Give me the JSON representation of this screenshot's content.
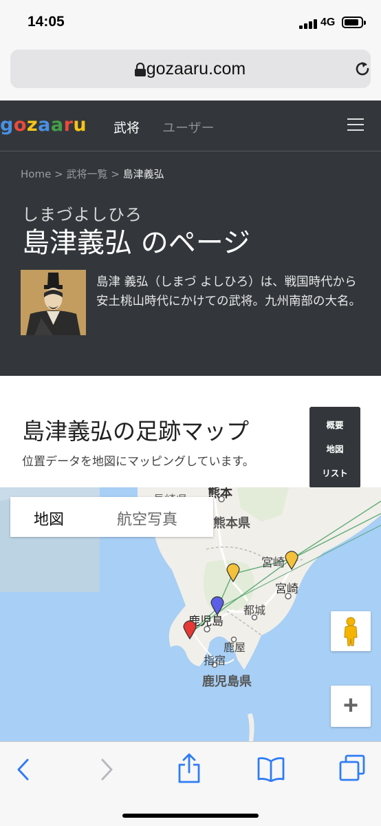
{
  "status": {
    "time": "14:05",
    "network": "4G"
  },
  "browser": {
    "url": "gozaaru.com"
  },
  "site": {
    "logo_letters": [
      {
        "ch": "g",
        "color": "#4a90e2"
      },
      {
        "ch": "o",
        "color": "#e94b3c"
      },
      {
        "ch": "z",
        "color": "#f5c518"
      },
      {
        "ch": "a",
        "color": "#4a90e2"
      },
      {
        "ch": "a",
        "color": "#43a047"
      },
      {
        "ch": "r",
        "color": "#e94b3c"
      },
      {
        "ch": "u",
        "color": "#f5c518"
      }
    ],
    "nav": {
      "busho": "武将",
      "users": "ユーザー"
    }
  },
  "breadcrumb": {
    "home": "Home",
    "sep1": ">",
    "list": "武将一覧",
    "sep2": ">",
    "current": "島津義弘"
  },
  "hero": {
    "ruby": "しまづよしひろ",
    "title": "島津義弘 のページ",
    "description": "島津 義弘（しまづ よしひろ）は、戦国時代から安土桃山時代にかけての武将。九州南部の大名。"
  },
  "section": {
    "title": "島津義弘の足跡マップ",
    "subtitle": "位置データを地図にマッピングしています。"
  },
  "side_menu": {
    "overview": "概要",
    "map": "地図",
    "list": "リスト"
  },
  "map": {
    "tabs": {
      "map": "地図",
      "satellite": "航空写真"
    },
    "labels": {
      "nagasaki": "長崎県",
      "kumamoto_city": "熊本",
      "kumamoto_pref": "熊本県",
      "miyazaki_city_top": "宮崎",
      "miyazaki": "宮崎",
      "miyakonojo": "都城",
      "kagoshima": "鹿児島",
      "kanoya": "鹿屋",
      "ibusuki": "指宿",
      "kagoshima_pref": "鹿児島県"
    },
    "markers": [
      {
        "color": "#f3c23a"
      },
      {
        "color": "#f3c23a"
      },
      {
        "color": "#5b5fe8"
      },
      {
        "color": "#e53935"
      }
    ],
    "zoom_in": "+"
  },
  "colors": {
    "header_bg": "#33373b",
    "nav_active": "#ffffff",
    "nav_inactive": "#8a8e92",
    "ios_blue": "#2f7cf6"
  }
}
